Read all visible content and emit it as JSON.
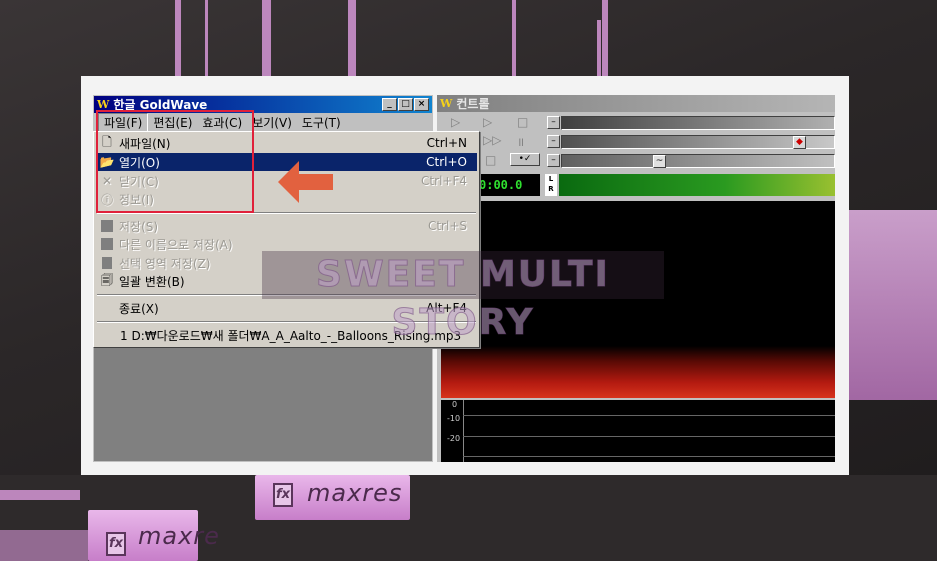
{
  "app": {
    "title": "한글 GoldWave",
    "logo_glyph": "W",
    "window_buttons": [
      "_",
      "□",
      "×"
    ]
  },
  "menubar": [
    {
      "label": "파일(F)",
      "open": true
    },
    {
      "label": "편집(E)"
    },
    {
      "label": "효과(C)"
    },
    {
      "label": "보기(V)"
    },
    {
      "label": "도구(T)"
    }
  ],
  "file_menu": {
    "items": [
      {
        "label": "새파일(N)",
        "shortcut": "Ctrl+N",
        "icon": "new-file-icon",
        "state": "normal"
      },
      {
        "label": "열기(O)",
        "shortcut": "Ctrl+O",
        "icon": "open-folder-icon",
        "state": "selected"
      },
      {
        "label": "닫기(C)",
        "shortcut": "Ctrl+F4",
        "icon": "close-x-icon",
        "state": "disabled"
      },
      {
        "label": "정보(I)",
        "shortcut": "",
        "icon": "info-icon",
        "state": "disabled"
      },
      {
        "label": "저장(S)",
        "shortcut": "Ctrl+S",
        "icon": "save-icon",
        "state": "disabled"
      },
      {
        "label": "다른 이름으로 저장(A)",
        "shortcut": "",
        "icon": "save-as-icon",
        "state": "disabled"
      },
      {
        "label": "선택 영역 저장(Z)",
        "shortcut": "",
        "icon": "save-selection-icon",
        "state": "disabled"
      },
      {
        "label": "일괄 변환(B)",
        "shortcut": "",
        "icon": "batch-convert-icon",
        "state": "normal"
      },
      {
        "label": "종료(X)",
        "shortcut": "Alt+F4",
        "icon": "",
        "state": "normal"
      },
      {
        "label": "1 D:₩다운로드₩새 폴더₩A_A_Aalto_-_Balloons_Rising.mp3",
        "shortcut": "",
        "icon": "",
        "state": "normal"
      }
    ]
  },
  "control_window": {
    "title": "컨트롤",
    "time_display": "0:00.0",
    "meter_labels": [
      "L",
      "R"
    ],
    "db_scale": [
      "0",
      "-10",
      "-20"
    ]
  },
  "watermark": {
    "text": "SWEET MULTI STORY"
  },
  "background": {
    "clip_labels": [
      "fx",
      "maxres",
      "fx",
      "maxre"
    ]
  },
  "colors": {
    "title_active": "#000080",
    "menu_selection": "#0a246a",
    "annotation_red": "#e0203a",
    "arrow_orange": "#e2613f",
    "clip_pink": "#d596d6"
  }
}
